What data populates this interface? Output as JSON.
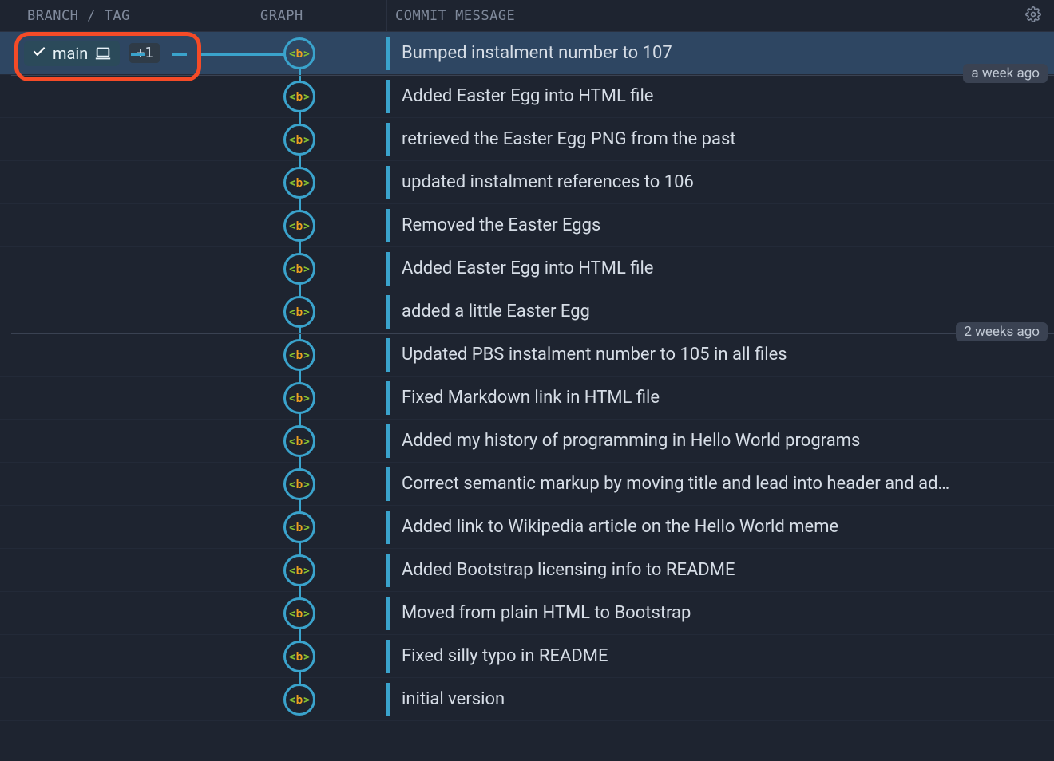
{
  "headers": {
    "branch": "BRANCH / TAG",
    "graph": "GRAPH",
    "message": "COMMIT MESSAGE"
  },
  "branch_pill": {
    "name": "main",
    "checked": true,
    "extra_badge": "+1"
  },
  "node_glyph": "<b>",
  "time_dividers": [
    {
      "label": "a week ago",
      "after_row": 0
    },
    {
      "label": "2 weeks ago",
      "after_row": 6
    }
  ],
  "commits": [
    {
      "message": "Bumped instalment number to 107",
      "selected": true,
      "has_branch": true
    },
    {
      "message": "Added Easter Egg into HTML file"
    },
    {
      "message": "retrieved the Easter Egg PNG from the past"
    },
    {
      "message": "updated instalment references to 106"
    },
    {
      "message": "Removed the Easter Eggs"
    },
    {
      "message": "Added Easter Egg into HTML file"
    },
    {
      "message": "added a little Easter Egg"
    },
    {
      "message": "Updated PBS instalment number to 105 in all files"
    },
    {
      "message": "Fixed Markdown link in HTML file"
    },
    {
      "message": "Added my history of programming in Hello World programs"
    },
    {
      "message": "Correct semantic markup by moving title and lead into header and ad…"
    },
    {
      "message": "Added link to Wikipedia article on the Hello World meme"
    },
    {
      "message": "Added Bootstrap licensing info to README"
    },
    {
      "message": "Moved from plain HTML to Bootstrap"
    },
    {
      "message": "Fixed silly typo in README"
    },
    {
      "message": "initial version"
    }
  ]
}
